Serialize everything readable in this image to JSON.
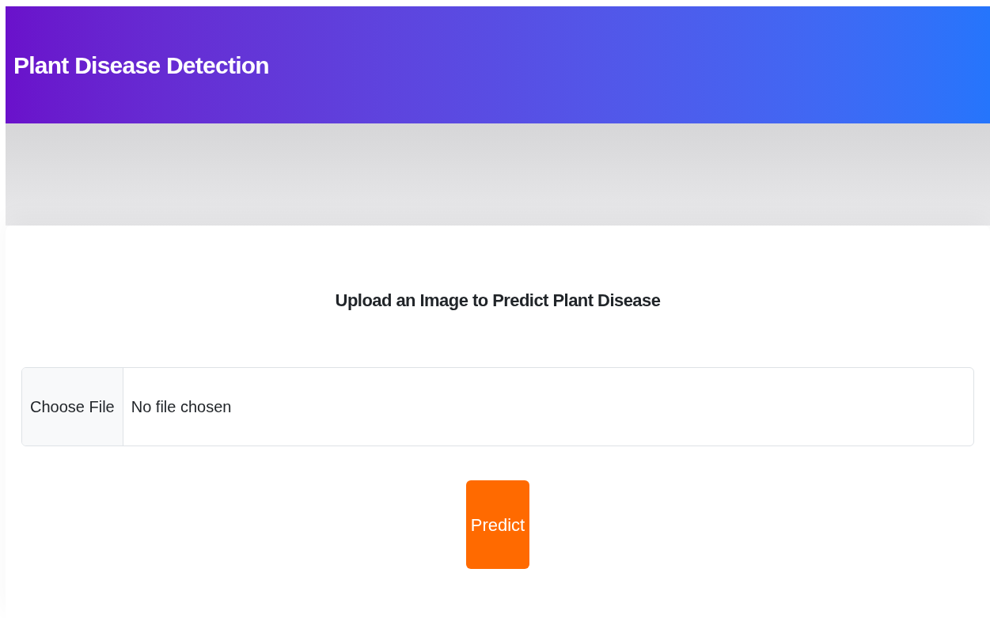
{
  "header": {
    "title": "Plant Disease Detection"
  },
  "card": {
    "heading": "Upload an Image to Predict Plant Disease",
    "file_input": {
      "button": "Choose File",
      "value": "No file chosen"
    },
    "submit": "Predict"
  }
}
